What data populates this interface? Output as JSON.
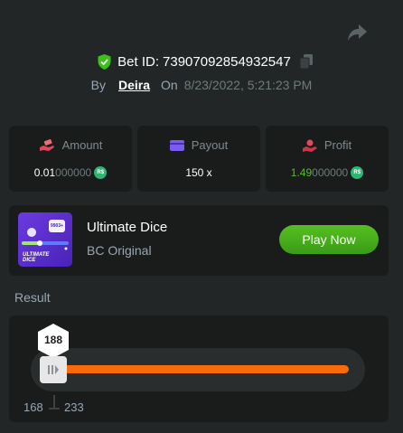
{
  "header": {
    "bet_label": "Bet ID:",
    "bet_id": "73907092854932547",
    "by_label": "By",
    "username": "Deira",
    "on_label": "On",
    "datetime": "8/23/2022, 5:21:23 PM"
  },
  "stats": {
    "amount": {
      "label": "Amount",
      "value_bright": "0.01",
      "value_dim": "000000",
      "currency": "R$"
    },
    "payout": {
      "label": "Payout",
      "value": "150 x"
    },
    "profit": {
      "label": "Profit",
      "value_bright": "1.49",
      "value_dim": "000000",
      "currency": "R$"
    }
  },
  "game": {
    "title": "Ultimate Dice",
    "subtitle": "BC Original",
    "play_label": "Play Now",
    "thumb_text_1": "ULTIMATE",
    "thumb_text_2": "DICE",
    "thumb_badge": "9903+"
  },
  "result": {
    "label": "Result",
    "value": "188",
    "range_low": "168",
    "range_high": "233"
  },
  "icons": {
    "share": "share-icon",
    "shield": "shield-check-icon",
    "copy": "copy-icon",
    "amount": "money-hand-icon",
    "payout": "card-icon",
    "profit": "profit-hand-icon",
    "knob": "slider-handle-icon"
  },
  "colors": {
    "background": "#232626",
    "panel": "#1a1c1c",
    "green": "#4fc11d",
    "orange_bar": "#f86a0a",
    "play_button": "#3fa51c"
  }
}
